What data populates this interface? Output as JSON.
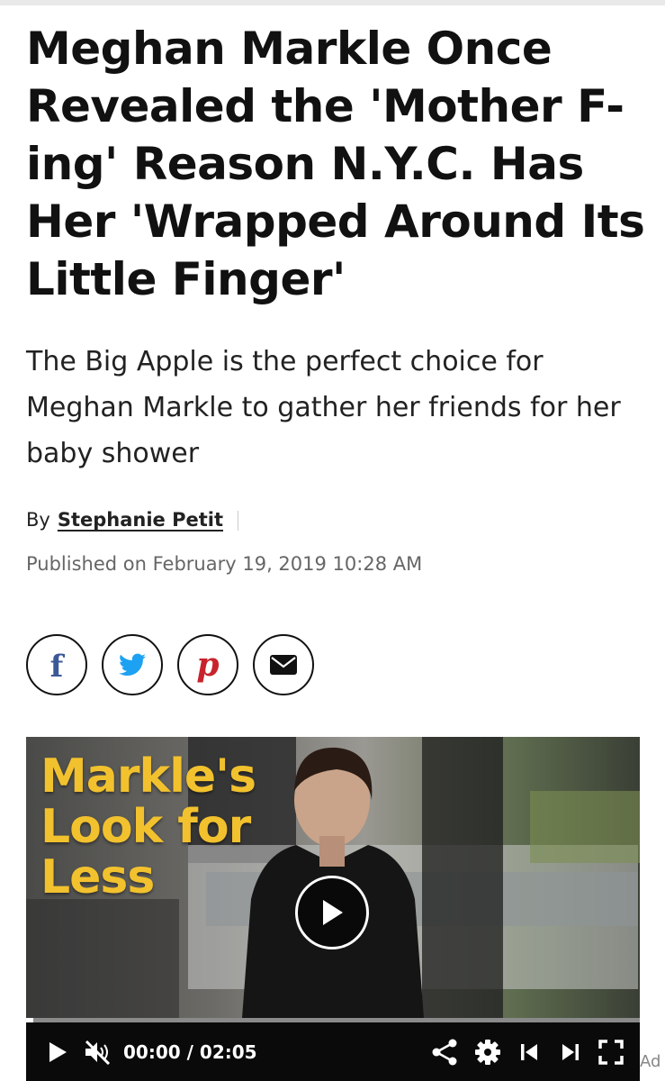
{
  "article": {
    "headline": "Meghan Markle Once Revealed the 'Mother F-ing' Reason N.Y.C. Has Her 'Wrapped Around Its Little Finger'",
    "dek": "The Big Apple is the perfect choice for Meghan Markle to gather her friends for her baby shower",
    "byline_prefix": "By",
    "author": "Stephanie Petit",
    "published": "Published on February 19, 2019 10:28 AM"
  },
  "share": [
    {
      "network": "facebook",
      "icon": "facebook-icon",
      "color": "#3b5998"
    },
    {
      "network": "twitter",
      "icon": "twitter-icon",
      "color": "#1da1f2"
    },
    {
      "network": "pinterest",
      "icon": "pinterest-icon",
      "color": "#c8232c"
    },
    {
      "network": "email",
      "icon": "email-icon",
      "color": "#111111"
    }
  ],
  "video": {
    "overlay_line1": "Markle's",
    "overlay_line2": "Look for",
    "overlay_line3": "Less",
    "current_time": "00:00",
    "time_separator": "/",
    "duration": "02:05",
    "progress_fraction": 0.0,
    "overlay_color": "#f2c12e",
    "controls": [
      "play-icon",
      "mute-icon",
      "share-icon",
      "settings-icon",
      "previous-icon",
      "next-icon",
      "fullscreen-icon"
    ]
  },
  "ad_label": "Ad"
}
